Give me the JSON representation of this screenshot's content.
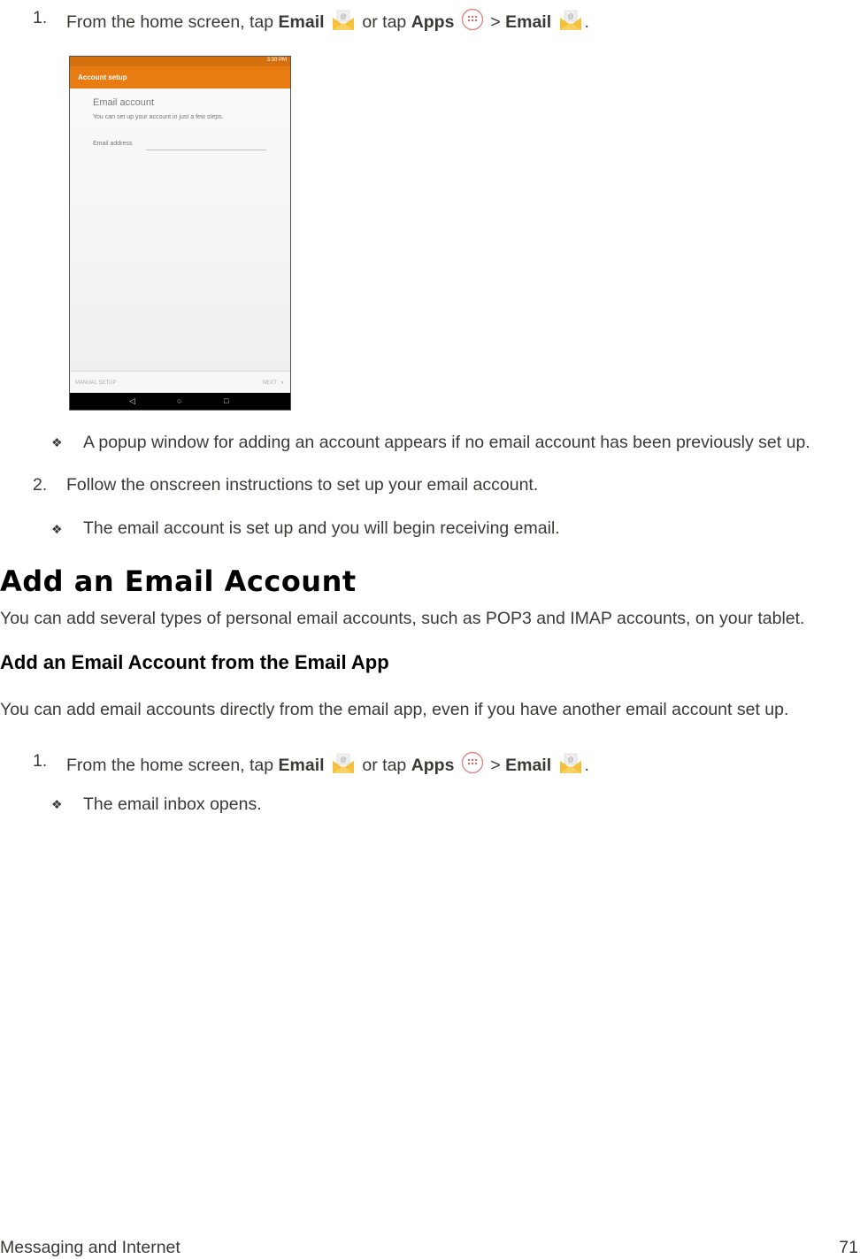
{
  "steps_top": [
    {
      "number": "1.",
      "prefix": "From the home screen, tap ",
      "email_label": "Email",
      "middle": " or tap ",
      "apps_label": "Apps",
      "separator": " > ",
      "email_label_2": "Email",
      "suffix": "."
    }
  ],
  "phone_screenshot": {
    "status_time": "3:30 PM",
    "app_bar_title": "Account setup",
    "heading": "Email account",
    "subtitle": "You can set up your account in just a few steps.",
    "field_label": "Email address",
    "field_value": "",
    "manual_setup": "MANUAL SETUP",
    "next": "NEXT",
    "next_chevron": "›",
    "nav_back": "◁",
    "nav_home": "○",
    "nav_recent": "□",
    "colors": {
      "status_bar": "#d4700e",
      "app_bar": "#e87c12"
    }
  },
  "note_1": "A popup window for adding an account appears if no email account has been previously set up.",
  "step_2": {
    "number": "2.",
    "text": "Follow the onscreen instructions to set up your email account."
  },
  "note_2": "The email account is set up and you will begin receiving email.",
  "section": {
    "title": "Add an Email Account",
    "intro": "You can add several types of personal email accounts, such as POP3 and IMAP accounts, on your tablet.",
    "subsection_title": "Add an Email Account from the Email App",
    "subsection_intro": "You can add email accounts directly from the email app, even if you have another email account set up.",
    "step_1": {
      "number": "1.",
      "prefix": "From the home screen, tap ",
      "email_label": "Email",
      "middle": " or tap ",
      "apps_label": "Apps",
      "separator": " > ",
      "email_label_2": "Email",
      "suffix": "."
    },
    "note": "The email inbox opens."
  },
  "bullet_glyph": "❖",
  "icons": {
    "email": "email-envelope-icon",
    "apps": "apps-grid-icon"
  },
  "footer": {
    "section": "Messaging and Internet",
    "page": "71"
  }
}
